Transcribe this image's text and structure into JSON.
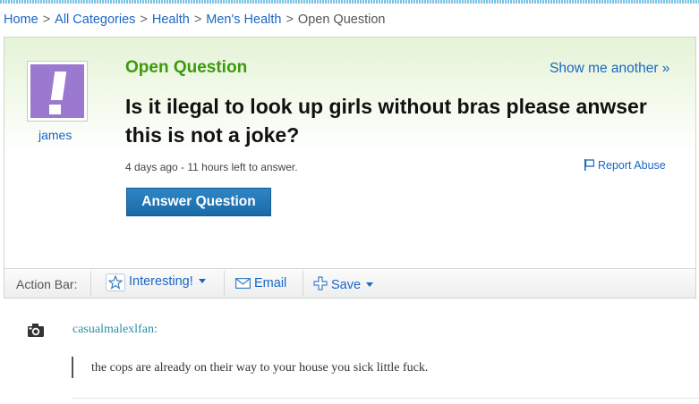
{
  "breadcrumb": {
    "items": [
      "Home",
      "All Categories",
      "Health",
      "Men's Health"
    ],
    "separator": ">",
    "current": "Open Question"
  },
  "question": {
    "status": "Open Question",
    "show_another": "Show me another »",
    "title": "Is it ilegal to look up girls without bras please anwser this is not a joke?",
    "meta": "4 days ago - 11 hours left to answer.",
    "report_abuse": "Report Abuse",
    "answer_button": "Answer Question",
    "asker": {
      "name": "james",
      "avatar_color": "#9b79cf"
    }
  },
  "action_bar": {
    "label": "Action Bar:",
    "interesting": "Interesting!",
    "email": "Email",
    "save": "Save"
  },
  "post": {
    "author": "casualmalexlfan:",
    "comment": "the cops are already on their way to your house you sick little fuck."
  },
  "colors": {
    "link": "#1a66c4",
    "status_green": "#3c9a0c",
    "button_blue": "#1b6aa8",
    "commenter_teal": "#2a8fa8"
  },
  "icons": [
    "star-icon",
    "mail-icon",
    "plus-icon",
    "flag-icon",
    "camera-icon",
    "chevron-down-icon"
  ]
}
